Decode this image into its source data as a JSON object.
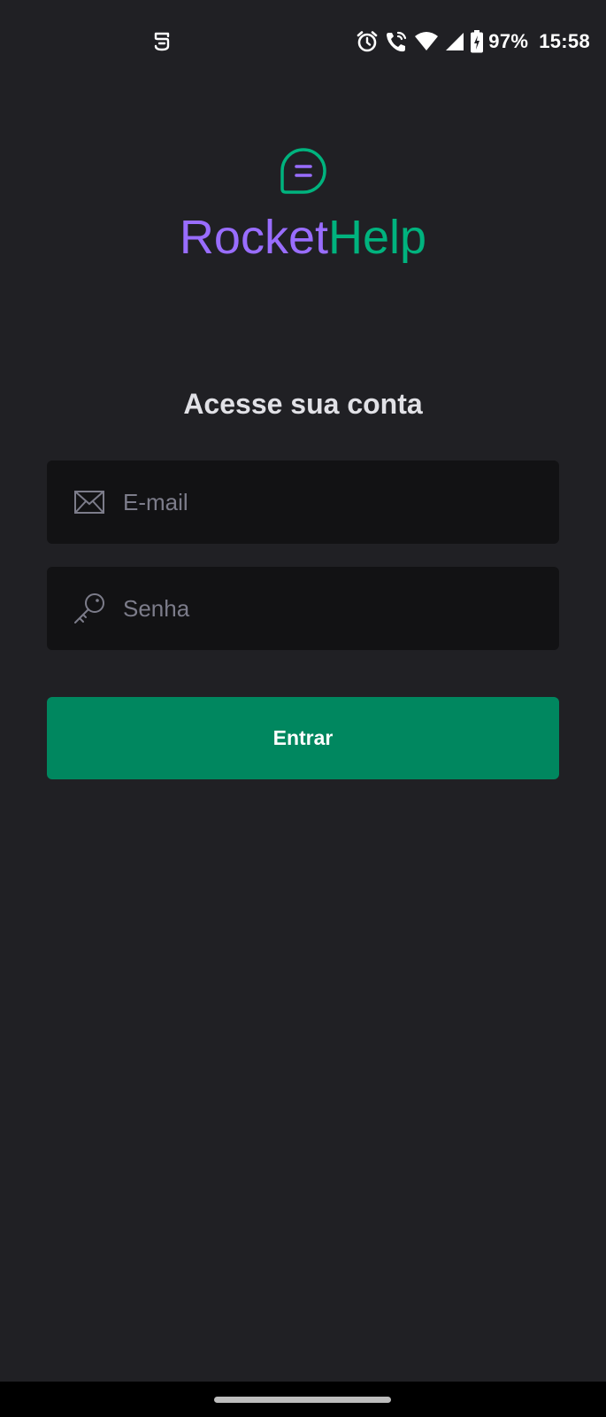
{
  "status_bar": {
    "left_icon": "notification-app-icon",
    "icons": [
      "alarm-icon",
      "wifi-calling-icon",
      "wifi-icon",
      "signal-icon",
      "battery-charging-icon"
    ],
    "battery": "97%",
    "time": "15:58"
  },
  "brand": {
    "logo_icon": "chat-bubble-icon",
    "name_part1": "Rocket",
    "name_part2": "Help",
    "colors": {
      "primary": "#996dff",
      "secondary": "#00b37e"
    }
  },
  "login": {
    "heading": "Acesse sua conta",
    "email": {
      "icon": "envelope-icon",
      "value": "",
      "placeholder": "E-mail"
    },
    "password": {
      "icon": "key-icon",
      "value": "",
      "placeholder": "Senha"
    },
    "submit_label": "Entrar"
  },
  "theme": {
    "background": "#202024",
    "input_background": "#121214",
    "button_color": "#00875f",
    "placeholder_color": "#7c7c8a"
  }
}
